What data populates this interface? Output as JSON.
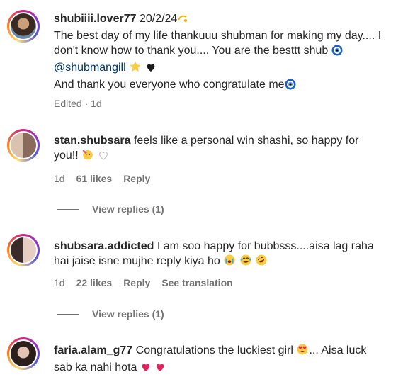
{
  "comments": [
    {
      "username": "shubiiii.lover77",
      "date": "20/2/24",
      "line1": "The best day of my life thankuuu shubman for making my day.... I",
      "line2": "don't know how to thank you.... You are the besttt shub",
      "mention": "@shubmangill",
      "line4": "And thank you everyone who congratulate me",
      "meta": "Edited · 1d"
    },
    {
      "username": "stan.shubsara",
      "text_a": "feels like a personal win shashi, so happy for",
      "text_b": "you!!",
      "time": "1d",
      "likes": "61 likes",
      "reply": "Reply",
      "view_replies": "View replies (1)"
    },
    {
      "username": "shubsara.addicted",
      "text_a": "I am soo happy for bubbsss....aisa lag raha",
      "text_b": "hai jaise isne mujhe reply kiya ho",
      "time": "1d",
      "likes": "22 likes",
      "reply": "Reply",
      "translation": "See translation",
      "view_replies": "View replies (1)"
    },
    {
      "username": "faria.alam_g77",
      "text_a": "Congratulations the luckiest girl",
      "text_a2": "... Aisa luck",
      "text_b": "sab ka nahi hota"
    }
  ],
  "colors": {
    "text": "#262626",
    "meta": "#737373",
    "heart_red": "#e0245e",
    "evil_eye_blue": "#1f5fbf"
  },
  "icons": [
    "evil-eye-icon",
    "star-icon",
    "black-heart-icon",
    "partying-face-icon",
    "white-heart-icon",
    "crying-face-icon",
    "joy-face-icon",
    "rofl-face-icon",
    "heart-eyes-icon",
    "red-heart-icon"
  ]
}
